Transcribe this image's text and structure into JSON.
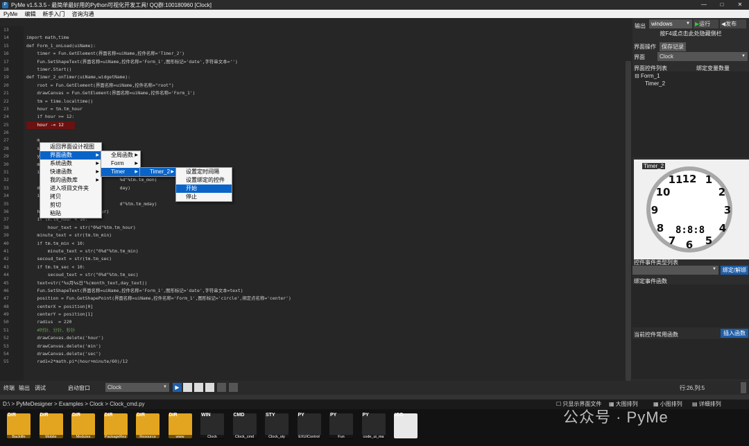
{
  "titlebar": {
    "title": "PyMe v1.5.3.5 - 最简单最好用的Python可视化开发工具! QQ群:100180960   [Clock]",
    "minimize": "—",
    "maximize": "□",
    "close": "✕"
  },
  "menubar": {
    "items": [
      "PyMe",
      "编辑",
      "新手入门",
      "咨询沟通"
    ]
  },
  "editor": {
    "line_numbers": [
      "13",
      "14",
      "15",
      "16",
      "17",
      "18",
      "19",
      "20",
      "21",
      "22",
      "23",
      "24",
      "25",
      "26",
      "27",
      "28",
      "29",
      "30",
      "31",
      "32",
      "33",
      "34",
      "35",
      "36",
      "37",
      "38",
      "39",
      "40",
      "41",
      "42",
      "43",
      "44",
      "45",
      "46",
      "47",
      "48",
      "49",
      "50",
      "51",
      "52",
      "53",
      "54",
      "55"
    ],
    "code_lines": [
      "",
      "import math,time",
      "def Form_1_onLoad(uiName):",
      "    timer = Fun.GetElement(界面名称=uiName,控件名称='Timer_2')",
      "    Fun.SetShapeText(界面名称=uiName,控件名称='Form_1',图形标记='date',字符串文本='')",
      "    timer.Start()",
      "def Timer_2_onTimer(uiName,widgetName):",
      "    root = Fun.GetElement(界面名称=uiName,控件名称=\"root\")",
      "    drawCanvas = Fun.GetElement(界面名称=uiName,控件名称='Form_1')",
      "    tm = time.localtime()",
      "    hour = tm.tm_hour",
      "    if hour >= 12:",
      "    hour -= 12",
      "",
      "    m",
      "    s",
      "    y",
      "    m",
      "    i",
      "                                   %d\"%tm.tm_mon)",
      "    d                              day)",
      "    i",
      "                                   d\"%tm.tm_mday)",
      "    hour_text = str(tm.tm_hour)",
      "    if tm.tm_hour < 10:",
      "        hour_text = str(\"0%d\"%tm.tm_hour)",
      "    minute_text = str(tm.tm_min)",
      "    if tm.tm_min < 10:",
      "        minute_text = str(\"0%d\"%tm.tm_min)",
      "    secoud_text = str(tm.tm_sec)",
      "    if tm.tm_sec < 10:",
      "        secoud_text = str(\"0%d\"%tm.tm_sec)",
      "    text=str(\"%s月%s日\"%(month_text,day_text))",
      "    Fun.SetShapeText(界面名称=uiName,控件名称='Form_1',图形标记='date',字符串文本=text)",
      "    position = Fun.GetShapePoint(界面名称=uiName,控件名称='Form_1',图形标记='circle',绑定点名称='center')",
      "    centerX = position[0]",
      "    centerY = position[1]",
      "    radius  = 220",
      "    #时针、分针、秒针",
      "    drawCanvas.delete('hour')",
      "    drawCanvas.delete('min')",
      "    drawCanvas.delete('sec')",
      "    rad1=2*math.pi*(hour+minute/60)/12"
    ]
  },
  "context_menu": {
    "main": [
      "返回界面设计视图",
      "界面函数",
      "系统函数",
      "快速函数",
      "我的函数库",
      "进入项目文件夹",
      "拷贝",
      "剪切",
      "粘贴"
    ],
    "sub1": [
      "全局函数",
      "Form",
      "Timer"
    ],
    "sub2": [
      "Timer_2"
    ],
    "sub3": [
      "设置定时间隔",
      "设置绑定的控件",
      "开始",
      "停止"
    ]
  },
  "right_panel": {
    "output_label": "输出",
    "platform": "windows",
    "run_label": "运行",
    "publish_label": "发布",
    "hint": "按F4或点击此处隐藏侧栏",
    "tabs": [
      "界面操作",
      "保存记录"
    ],
    "interface_label": "界面",
    "interface_value": "Clock",
    "control_list_label": "界面控件列表",
    "bind_count_label": "绑定变量数量",
    "tree": [
      "Form_1",
      "Timer_2"
    ],
    "preview_tag": "Timer_2",
    "clock_digital": "8:8:8",
    "event_type_label": "控件事件类型列表",
    "bind_button": "绑定/解绑",
    "bind_func_label": "绑定事件函数",
    "common_func_label": "当前控件常用函数",
    "insert_button": "插入函数"
  },
  "bottombar": {
    "tabs": [
      "终端",
      "输出",
      "调试"
    ],
    "startup_label": "启动窗口",
    "startup_value": "Clock",
    "cursor_pos": "行:26,列:5"
  },
  "pathbar": {
    "path": "D:\\ > PyMeDesigner > Examples > Clock > Clock_cmd.py",
    "options": [
      "只显示界面文件",
      "大图排列",
      "小图排列",
      "详细排列"
    ]
  },
  "files": [
    {
      "tag": "DIR",
      "name": "Backlife",
      "color": "#e3a51f"
    },
    {
      "tag": "DIR",
      "name": "Mobile",
      "color": "#e3a51f"
    },
    {
      "tag": "DIR",
      "name": "Modules",
      "color": "#e3a51f"
    },
    {
      "tag": "DIR",
      "name": "PackageRes",
      "color": "#e3a51f"
    },
    {
      "tag": "DIR",
      "name": "Resource",
      "color": "#e3a51f"
    },
    {
      "tag": "DIR",
      "name": "www",
      "color": "#e3a51f"
    },
    {
      "tag": "WIN",
      "name": "Clock",
      "color": "#2a2a2a"
    },
    {
      "tag": "CMD",
      "name": "Clock_cmd",
      "color": "#2a2a2a"
    },
    {
      "tag": "STY",
      "name": "Clock_sty",
      "color": "#2a2a2a"
    },
    {
      "tag": "PY",
      "name": "EXUIControl",
      "color": "#2a2a2a"
    },
    {
      "tag": "PY",
      "name": "Fun",
      "color": "#2a2a2a"
    },
    {
      "tag": "PY",
      "name": "code_ui_ma",
      "color": "#2a2a2a"
    },
    {
      "tag": "ICO",
      "name": "",
      "color": "#e8e8e8"
    }
  ],
  "watermark": "公众号 · PyMe"
}
